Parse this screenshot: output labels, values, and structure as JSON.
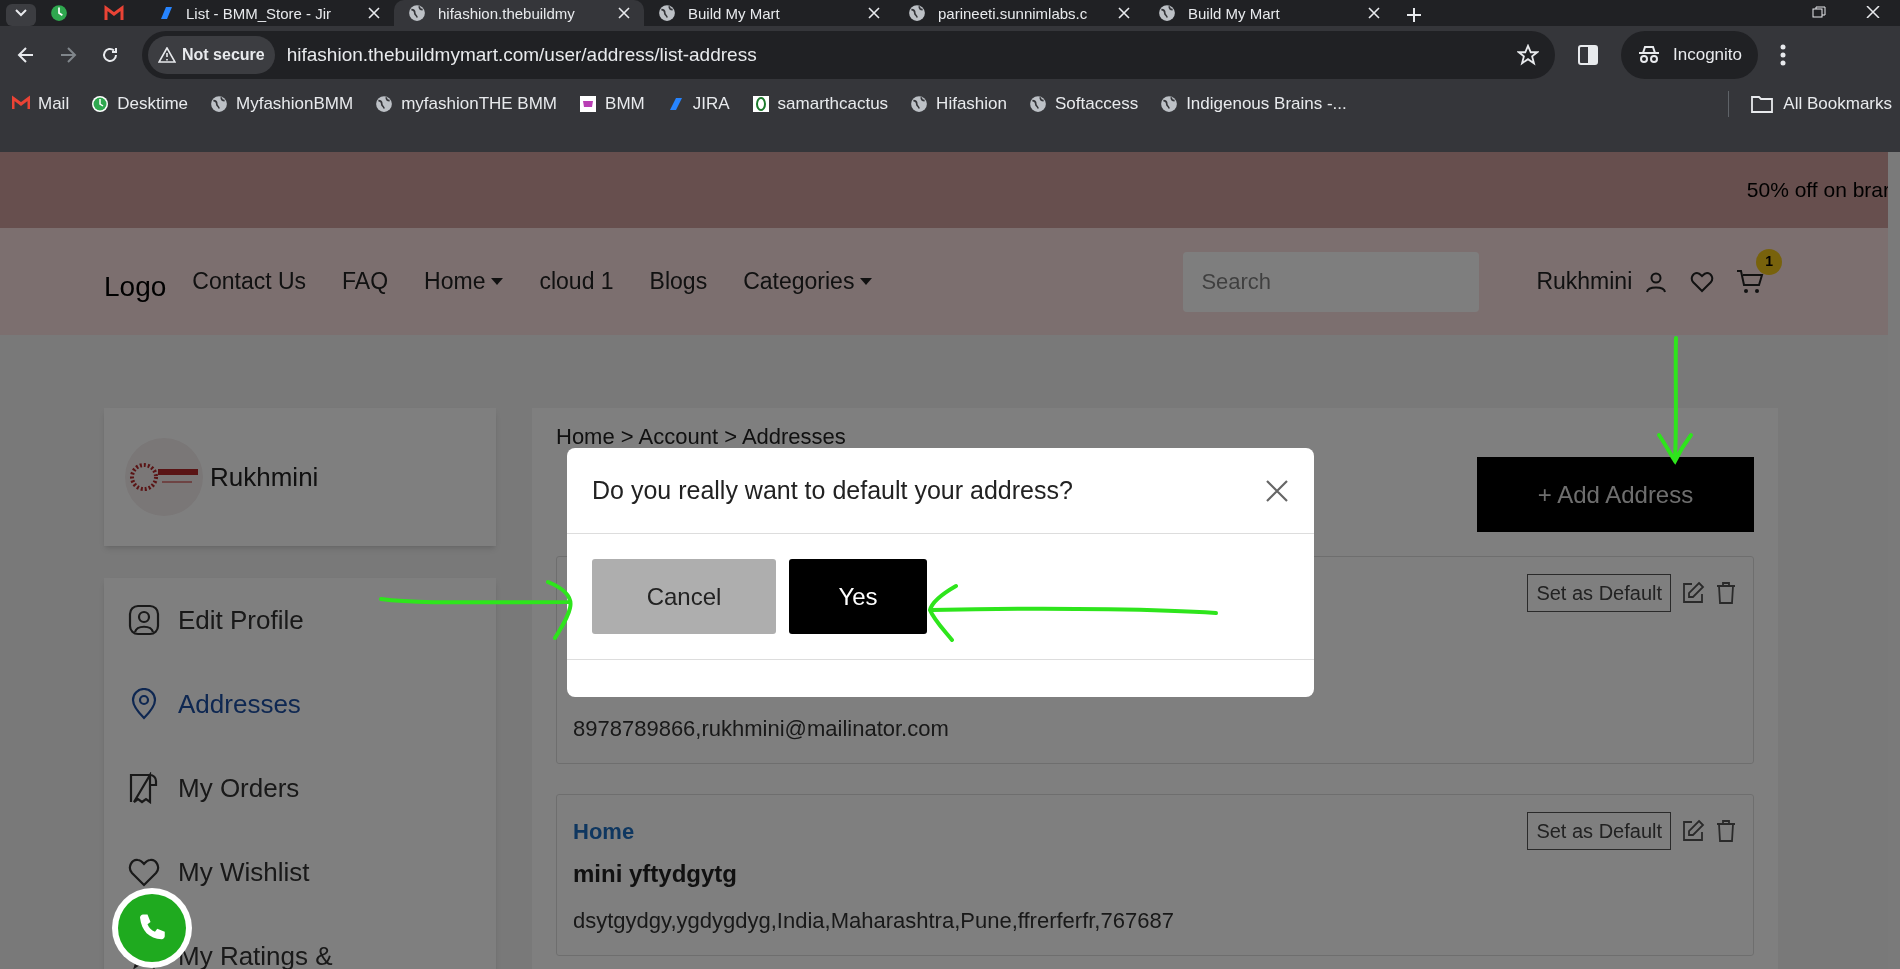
{
  "browser": {
    "tabs": [
      {
        "selected": false
      },
      {
        "selected": false
      },
      {
        "label": "List - BMM_Store - Jir",
        "selected": false
      },
      {
        "label": "hifashion.thebuildmy",
        "selected": true
      },
      {
        "label": "Build My Mart",
        "selected": false
      },
      {
        "label": "parineeti.sunnimlabs.c",
        "selected": false
      },
      {
        "label": "Build My Mart",
        "selected": false
      }
    ],
    "security": "Not secure",
    "url": "hifashion.thebuildmymart.com/user/address/list-address",
    "profile": "Incognito",
    "bookmarks": [
      {
        "label": "Mail"
      },
      {
        "label": "Desktime"
      },
      {
        "label": "MyfashionBMM"
      },
      {
        "label": "myfashionTHE BMM"
      },
      {
        "label": "BMM"
      },
      {
        "label": "JIRA"
      },
      {
        "label": "samarthcactus"
      },
      {
        "label": "Hifashion"
      },
      {
        "label": "Softaccess"
      },
      {
        "label": "Indigenous Brains -..."
      }
    ],
    "all_bookmarks": "All Bookmarks"
  },
  "site": {
    "banner": "50% off on brar",
    "logo": "Logo",
    "nav": [
      {
        "label": "Contact Us",
        "dropdown": false
      },
      {
        "label": "FAQ",
        "dropdown": false
      },
      {
        "label": "Home",
        "dropdown": true
      },
      {
        "label": "cloud 1",
        "dropdown": false
      },
      {
        "label": "Blogs",
        "dropdown": false
      },
      {
        "label": "Categories",
        "dropdown": true
      }
    ],
    "search": {
      "placeholder": "Search"
    },
    "user": "Rukhmini",
    "cart_count": "1"
  },
  "profile": {
    "name": "Rukhmini"
  },
  "sidebar": {
    "items": [
      {
        "label": "Edit Profile",
        "selected": false
      },
      {
        "label": "Addresses",
        "selected": true
      },
      {
        "label": "My Orders",
        "selected": false
      },
      {
        "label": "My Wishlist",
        "selected": false
      },
      {
        "label": "My Ratings &",
        "selected": false
      }
    ]
  },
  "main": {
    "breadcrumb": "Home > Account > Addresses",
    "add_button": "+ Add Address",
    "addresses": [
      {
        "default_button": "Set as Default",
        "contact": "8978789866,rukhmini@mailinator.com"
      },
      {
        "label": "Home",
        "name": "mini yftydgytg",
        "address": "dsytgydgy,ygdygdyg,India,Maharashtra,Pune,ffrerferfr,767687",
        "default_button": "Set as Default"
      }
    ]
  },
  "modal": {
    "title": "Do you really want to default your address?",
    "cancel": "Cancel",
    "confirm": "Yes"
  }
}
